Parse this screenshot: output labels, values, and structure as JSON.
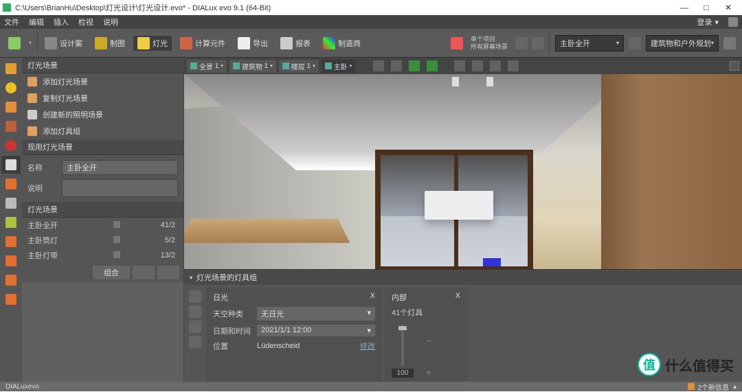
{
  "window": {
    "title": "C:\\Users\\BrianHu\\Desktop\\灯光设计\\灯光设计.evo* - DIALux evo 9.1  (64-Bit)",
    "min": "—",
    "max": "□",
    "close": "✕"
  },
  "menu": {
    "items": [
      "文件",
      "编辑",
      "插入",
      "检视",
      "说明"
    ],
    "login": "登录",
    "login_arrow": "▾"
  },
  "toolbar": {
    "items": [
      "设计案",
      "制图",
      "灯光",
      "计算元件",
      "导出",
      "报表",
      "制造商"
    ],
    "active_index": 2,
    "right_opt1": "单个项目",
    "right_opt2": "所有屏幕场景",
    "dd1": "主卧全开",
    "dd2": "建筑物和户外规划"
  },
  "left_tools_count": 13,
  "panel": {
    "title1": "灯光场景",
    "actions": [
      "添加灯光场景",
      "复制灯光场景",
      "创建新的照明场景",
      "添加灯具组"
    ],
    "title2": "现用灯光场景",
    "name_label": "名称",
    "name_value": "主卧全开",
    "desc_label": "说明",
    "desc_value": "",
    "title3": "灯光场景",
    "scenes": [
      {
        "name": "主卧全开",
        "count": "41/2"
      },
      {
        "name": "主卧筒灯",
        "count": "5/2"
      },
      {
        "name": "主卧灯带",
        "count": "13/2"
      }
    ],
    "btn_group": "组合",
    "btn_a": "",
    "btn_b": ""
  },
  "viewbar": {
    "items": [
      {
        "label": "全景",
        "n": "1"
      },
      {
        "label": "建筑物",
        "n": "1"
      },
      {
        "label": "楼层",
        "n": "1"
      },
      {
        "label": "主卧",
        "n": ""
      }
    ]
  },
  "bottom": {
    "title": "灯光场景的灯具组",
    "g1_title": "日光",
    "g1_x": "X",
    "rows": [
      {
        "label": "天空种类",
        "value": "无日光",
        "type": "dd"
      },
      {
        "label": "日期和时间",
        "value": "2021/1/1 12:00",
        "type": "dd"
      },
      {
        "label": "位置",
        "value": "Lüdenscheid",
        "type": "link",
        "link": "修改"
      }
    ],
    "g2_title": "内部",
    "g2_x": "X",
    "g2_sub": "41个灯具",
    "slider_val": "100"
  },
  "status": {
    "left": "DIALuxevo",
    "right": "2个新信息",
    "arrow": "▴"
  },
  "watermark": {
    "char": "值",
    "text": "什么值得买"
  }
}
